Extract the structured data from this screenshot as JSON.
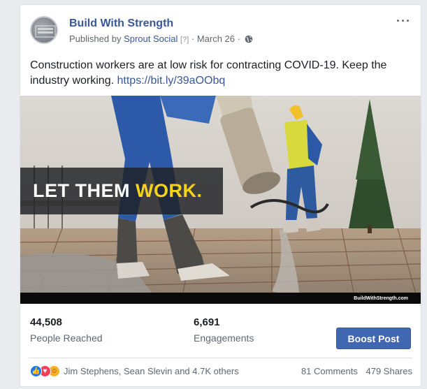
{
  "post": {
    "page_name": "Build With Strength",
    "avatar_text": "BUILD WITH STRENGTH",
    "published_by_prefix": "Published by",
    "publisher": "Sprout Social",
    "publisher_tag": "[?]",
    "date": "· March 26 ·",
    "more_label": "···",
    "text": "Construction workers are at low risk for contracting COVID-19. Keep the industry working.",
    "url": "https://bit.ly/39aOObq"
  },
  "image": {
    "headline_part1": "LET THEM ",
    "headline_part2": "WORK.",
    "watermark": "BuildWithStrength.com"
  },
  "stats": {
    "people_reached_value": "44,508",
    "people_reached_label": "People Reached",
    "engagements_value": "6,691",
    "engagements_label": "Engagements",
    "boost_label": "Boost Post"
  },
  "reactions": {
    "names": "Jim Stephens, Sean Slevin and 4.7K others",
    "comments": "81 Comments",
    "shares": "479 Shares",
    "icons": [
      "like-icon",
      "love-icon",
      "wow-icon"
    ]
  },
  "colors": {
    "link": "#385898",
    "boost": "#4267b2",
    "highlight": "#f5d31b"
  }
}
